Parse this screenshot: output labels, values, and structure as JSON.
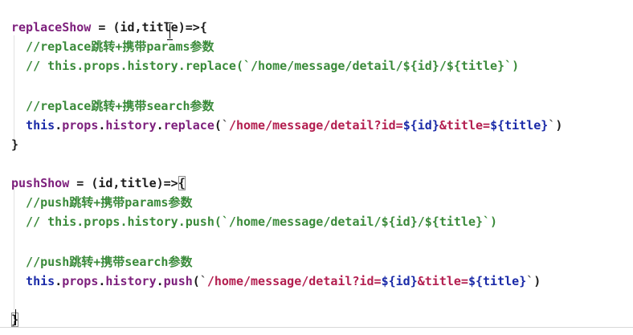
{
  "editor": {
    "lines": [
      [
        {
          "t": "replaceShow",
          "c": "t-f"
        },
        {
          "t": " = ",
          "c": "t-o"
        },
        {
          "t": "(id,title)",
          "c": "t-p"
        },
        {
          "t": "=>",
          "c": "t-o"
        },
        {
          "t": "{",
          "c": "t-br"
        }
      ],
      [
        {
          "t": "  //replace跳转+携带params参数",
          "c": "t-c"
        }
      ],
      [
        {
          "t": "  // this.props.history.replace(`/home/message/detail/${id}/${title}`)",
          "c": "t-c"
        }
      ],
      [],
      [
        {
          "t": "  //replace跳转+携带search参数",
          "c": "t-c"
        }
      ],
      [
        {
          "t": "  ",
          "c": "t-p"
        },
        {
          "t": "this",
          "c": "t-k"
        },
        {
          "t": ".",
          "c": "t-p"
        },
        {
          "t": "props",
          "c": "t-m"
        },
        {
          "t": ".",
          "c": "t-p"
        },
        {
          "t": "history",
          "c": "t-m"
        },
        {
          "t": ".",
          "c": "t-p"
        },
        {
          "t": "replace",
          "c": "t-m"
        },
        {
          "t": "(",
          "c": "t-p"
        },
        {
          "t": "`",
          "c": "t-bt"
        },
        {
          "t": "/home/message/detail?id=",
          "c": "t-i"
        },
        {
          "t": "${",
          "c": "t-s"
        },
        {
          "t": "id",
          "c": "t-s"
        },
        {
          "t": "}",
          "c": "t-s"
        },
        {
          "t": "&title=",
          "c": "t-i"
        },
        {
          "t": "${",
          "c": "t-s"
        },
        {
          "t": "title",
          "c": "t-s"
        },
        {
          "t": "}",
          "c": "t-s"
        },
        {
          "t": "`",
          "c": "t-bt"
        },
        {
          "t": ")",
          "c": "t-p"
        }
      ],
      [
        {
          "t": "}",
          "c": "t-br"
        }
      ],
      [],
      [
        {
          "t": "pushShow",
          "c": "t-f"
        },
        {
          "t": " = ",
          "c": "t-o"
        },
        {
          "t": "(id,title)",
          "c": "t-p"
        },
        {
          "t": "=>",
          "c": "t-o"
        },
        {
          "t": "{",
          "c": "t-br hl-paren"
        }
      ],
      [
        {
          "t": "  //push跳转+携带params参数",
          "c": "t-c"
        }
      ],
      [
        {
          "t": "  // this.props.history.push(`/home/message/detail/${id}/${title}`)",
          "c": "t-c"
        }
      ],
      [],
      [
        {
          "t": "  //push跳转+携带search参数",
          "c": "t-c"
        }
      ],
      [
        {
          "t": "  ",
          "c": "t-p"
        },
        {
          "t": "this",
          "c": "t-k"
        },
        {
          "t": ".",
          "c": "t-p"
        },
        {
          "t": "props",
          "c": "t-m"
        },
        {
          "t": ".",
          "c": "t-p"
        },
        {
          "t": "history",
          "c": "t-m"
        },
        {
          "t": ".",
          "c": "t-p"
        },
        {
          "t": "push",
          "c": "t-m"
        },
        {
          "t": "(",
          "c": "t-p"
        },
        {
          "t": "`",
          "c": "t-bt"
        },
        {
          "t": "/home/message/detail?id=",
          "c": "t-i"
        },
        {
          "t": "${",
          "c": "t-s"
        },
        {
          "t": "id",
          "c": "t-s"
        },
        {
          "t": "}",
          "c": "t-s"
        },
        {
          "t": "&title=",
          "c": "t-i"
        },
        {
          "t": "${",
          "c": "t-s"
        },
        {
          "t": "title",
          "c": "t-s"
        },
        {
          "t": "}",
          "c": "t-s"
        },
        {
          "t": "`",
          "c": "t-bt"
        },
        {
          "t": ")",
          "c": "t-p"
        }
      ],
      [],
      [
        {
          "t": "}",
          "c": "t-br hl-paren"
        }
      ]
    ]
  },
  "colors": {
    "background": "#ffffff",
    "comment": "#3a8a3a",
    "function": "#7d1f7c",
    "keyword": "#1a2aa8",
    "string": "#b31e4f"
  }
}
